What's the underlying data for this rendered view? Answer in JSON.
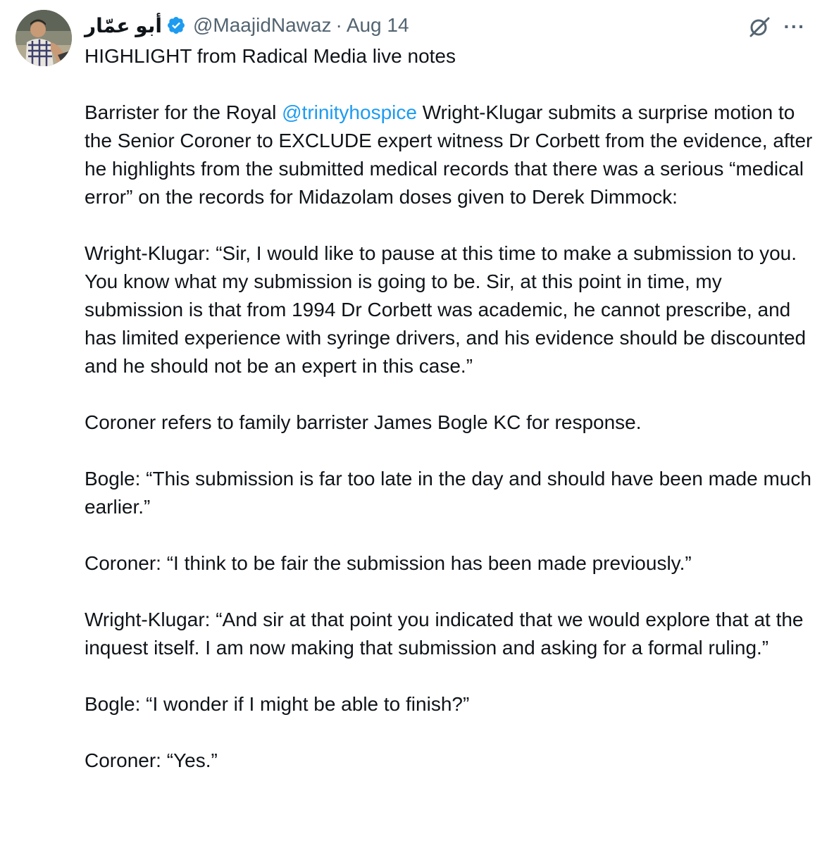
{
  "author": {
    "display_name": "أبو عمّار",
    "handle": "@MaajidNawaz",
    "separator": "·",
    "date": "Aug 14",
    "verified": true
  },
  "icons": {
    "verified": "verified-badge-icon",
    "grok": "grok-icon",
    "more": "more-icon"
  },
  "colors": {
    "accent": "#1d9bf0",
    "text": "#0f1419",
    "secondary": "#536471"
  },
  "tweet": {
    "line1": "HIGHLIGHT from Radical Media live notes",
    "p2_before": "Barrister for the Royal ",
    "p2_mention": "@trinityhospice",
    "p2_after": " Wright-Klugar submits a surprise motion to the Senior Coroner to EXCLUDE expert witness Dr Corbett from the evidence, after he highlights from the submitted medical records that there was a serious “medical error” on the records for Midazolam doses given to Derek Dimmock:",
    "p3": "Wright-Klugar: “Sir, I would like to pause at this time to make a submission to you. You know what my submission is going to be. Sir, at this point in time, my submission is that from 1994 Dr Corbett was academic, he cannot prescribe, and has limited experience with syringe drivers, and his evidence should be discounted and he should not be an expert in this case.”",
    "p4": "Coroner refers to family barrister James Bogle KC for response.",
    "p5": "Bogle: “This submission is far too late in the day and should have been made much earlier.”",
    "p6": "Coroner: “I think to be fair the submission has been made previously.”",
    "p7": "Wright-Klugar: “And sir at that point you indicated that we would explore that at the inquest itself. I am now making that submission and asking for a formal ruling.”",
    "p8": "Bogle: “I wonder if I might be able to finish?”",
    "p9": "Coroner: “Yes.”"
  }
}
